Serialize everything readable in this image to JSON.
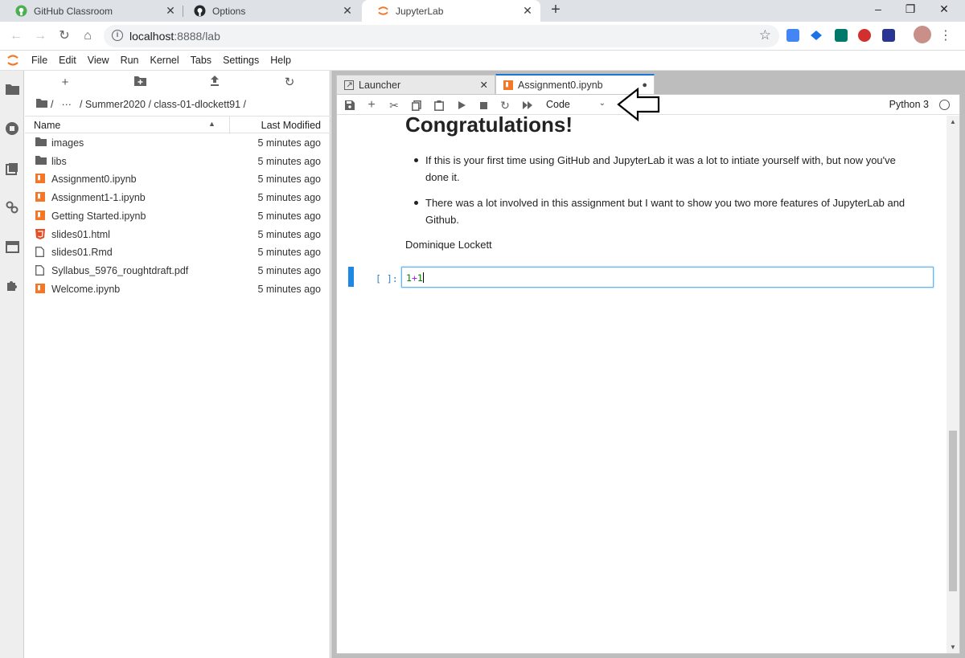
{
  "browser": {
    "tabs": [
      {
        "title": "GitHub Classroom",
        "icon": "github-classroom-icon",
        "active": false
      },
      {
        "title": "Options",
        "icon": "github-icon",
        "active": false
      },
      {
        "title": "JupyterLab",
        "icon": "jupyter-icon",
        "active": true
      }
    ],
    "new_tab_glyph": "+",
    "window_controls": {
      "minimize": "–",
      "restore": "❐",
      "close": "✕"
    },
    "url_host": "localhost",
    "url_rest": ":8888/lab"
  },
  "menubar": {
    "items": [
      "File",
      "Edit",
      "View",
      "Run",
      "Kernel",
      "Tabs",
      "Settings",
      "Help"
    ]
  },
  "filebrowser": {
    "breadcrumb": {
      "root_sep": "/",
      "ellipsis": "···",
      "path": "/ Summer2020 / class-01-dlockett91 /"
    },
    "columns": {
      "name": "Name",
      "modified": "Last Modified"
    },
    "files": [
      {
        "name": "images",
        "type": "folder",
        "modified": "5 minutes ago"
      },
      {
        "name": "libs",
        "type": "folder",
        "modified": "5 minutes ago"
      },
      {
        "name": "Assignment0.ipynb",
        "type": "notebook",
        "modified": "5 minutes ago"
      },
      {
        "name": "Assignment1-1.ipynb",
        "type": "notebook",
        "modified": "5 minutes ago"
      },
      {
        "name": "Getting Started.ipynb",
        "type": "notebook",
        "modified": "5 minutes ago"
      },
      {
        "name": "slides01.html",
        "type": "html",
        "modified": "5 minutes ago"
      },
      {
        "name": "slides01.Rmd",
        "type": "file",
        "modified": "5 minutes ago"
      },
      {
        "name": "Syllabus_5976_roughtdraft.pdf",
        "type": "file",
        "modified": "5 minutes ago"
      },
      {
        "name": "Welcome.ipynb",
        "type": "notebook",
        "modified": "5 minutes ago"
      }
    ]
  },
  "dock": {
    "tabs": [
      {
        "title": "Launcher",
        "close": "✕"
      },
      {
        "title": "Assignment0.ipynb",
        "close": "●"
      }
    ]
  },
  "notebook": {
    "cell_type": "Code",
    "kernel": "Python 3",
    "heading": "Congratulations!",
    "bullets": [
      "If this is your first time using GitHub and JupyterLab it was a lot to intiate yourself with, but now you've done it.",
      "There was a lot involved in this assignment but I want to show you two more features of JupyterLab and Github."
    ],
    "author": "Dominique Lockett",
    "prompt": "[ ]:",
    "code_left": "1",
    "code_op": "+",
    "code_right": "1"
  },
  "colors": {
    "jupyter_orange": "#f37726",
    "active_cell_blue": "#1e88e5",
    "chrome_tabstrip": "#dee1e6"
  }
}
